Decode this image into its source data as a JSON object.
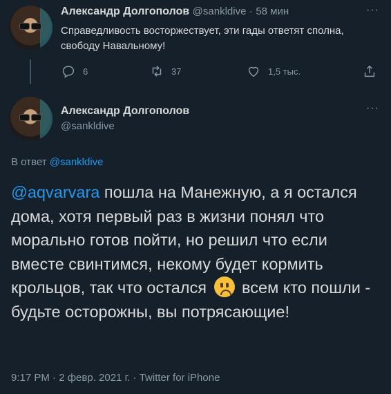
{
  "tweet1": {
    "display_name": "Александр Долгополов",
    "handle": "@sankldive",
    "separator": "·",
    "time": "58 мин",
    "text": "Справедливость восторжествует, эти гады ответят сполна, свободу Навальному!",
    "replies": "6",
    "retweets": "37",
    "likes": "1,5 тыс."
  },
  "tweet2": {
    "display_name": "Александр Долгополов",
    "handle": "@sankldive",
    "reply_prefix": "В ответ",
    "reply_to": "@sankldive",
    "mention": "@aqvarvara",
    "text_part1": " пошла на Манежную, а я остался дома, хотя первый раз в жизни понял что морально готов пойти, но решил что если вместе свинтимся, некому будет кормить крольцов, так что остался ",
    "text_part2": " всем кто пошли - будьте осторожны, вы потрясающие!",
    "footer": "9:17 PM · 2 февр. 2021 г. · Twitter for iPhone"
  },
  "icons": [
    "reply-icon",
    "retweet-icon",
    "like-icon",
    "share-icon",
    "frowning-emoji-icon"
  ],
  "colors": {
    "background": "#15202b",
    "link": "#1d9bf0",
    "muted": "#8899a6",
    "text": "#d9d9d9"
  }
}
